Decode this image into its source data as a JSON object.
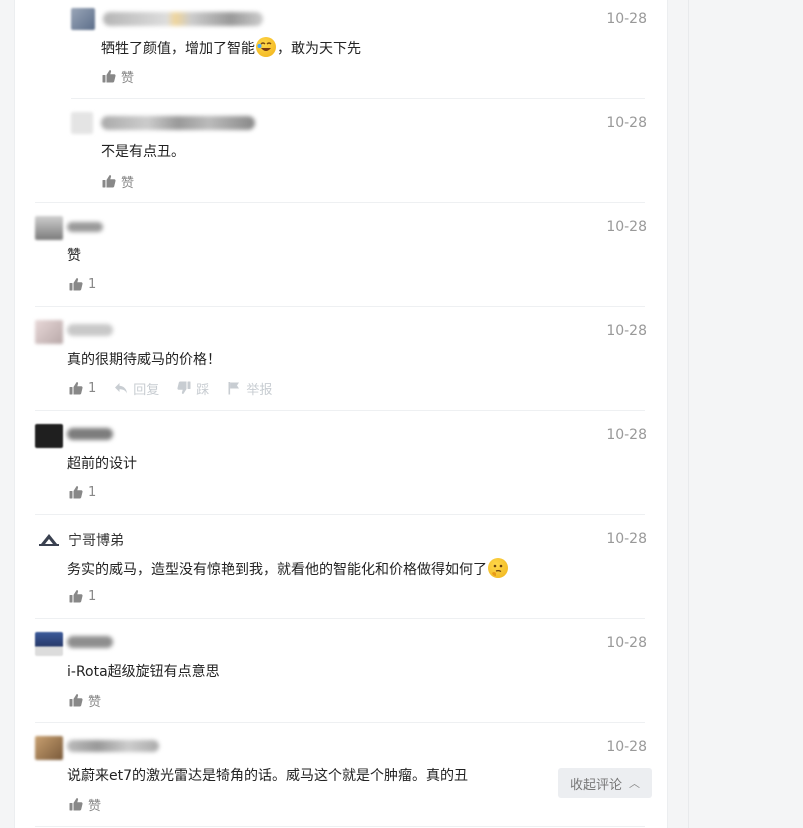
{
  "comments": [
    {
      "name": "",
      "date": "10-28",
      "text_before": "牺牲了颜值，增加了智能",
      "emoji": "laugh-cry-emoji",
      "text_after": "，敢为天下先",
      "like_label": "赞"
    },
    {
      "name": "",
      "date": "10-28",
      "text": "不是有点丑。",
      "like_label": "赞"
    },
    {
      "name": "",
      "date": "10-28",
      "text": "赞",
      "like_label": "1"
    },
    {
      "name": "",
      "date": "10-28",
      "text": "真的很期待威马的价格！",
      "like_label": "1",
      "reply_label": "回复",
      "dislike_label": "踩",
      "report_label": "举报"
    },
    {
      "name": "",
      "date": "10-28",
      "text": "超前的设计",
      "like_label": "1"
    },
    {
      "name": "宁哥博弟",
      "date": "10-28",
      "text": "务实的威马，造型没有惊艳到我，就看他的智能化和价格做得如何了",
      "emoji": "thinking-emoji",
      "like_label": "1"
    },
    {
      "name": "",
      "date": "10-28",
      "text": "i-Rota超级旋钮有点意思",
      "like_label": "赞"
    },
    {
      "name": "",
      "date": "10-28",
      "text": "说蔚来et7的激光雷达是犄角的话。威马这个就是个肿瘤。真的丑",
      "like_label": "赞"
    }
  ],
  "collapse_button": {
    "label": "收起评论",
    "icon": "chevron-up-icon"
  },
  "colors": {
    "date": "#999999",
    "action": "#888888",
    "action_light": "#c8cdd2",
    "divider": "#eef0f2"
  }
}
